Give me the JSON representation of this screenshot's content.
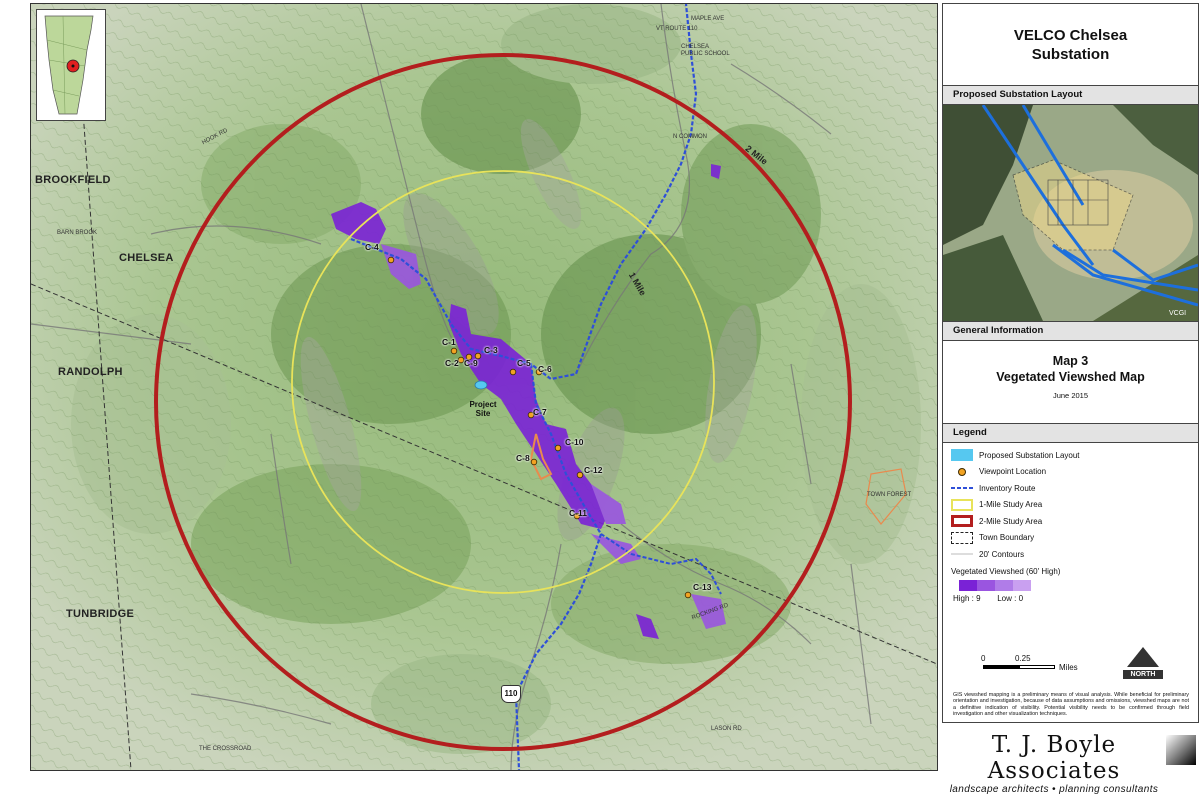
{
  "map": {
    "towns": [
      "BROOKFIELD",
      "CHELSEA",
      "RANDOLPH",
      "TUNBRIDGE"
    ],
    "ring_labels": {
      "one_mile": "1 Mile",
      "two_mile": "2 Mile"
    },
    "project_site_label": "Project Site",
    "route_shield": "110",
    "viewpoints": [
      "C-1",
      "C-2",
      "C-3",
      "C-4",
      "C-5",
      "C-6",
      "C-7",
      "C-8",
      "C-9",
      "C-10",
      "C-11",
      "C-12",
      "C-13"
    ],
    "road_labels": {
      "north_common": "N COMMON",
      "maple_ave": "MAPLE AVE",
      "vt110": "VT ROUTE 110",
      "school": "CHELSEA PUBLIC SCHOOL",
      "barn_brook": "BARN BROOK",
      "hook_rd": "HOOK RD",
      "town_forest": "TOWN FOREST",
      "the_crossroad": "THE CROSSROAD",
      "lasson_rd": "LASON RD",
      "rocking_rd": "ROCKING RD"
    },
    "colors": {
      "one_mile_ring": "#e8e35a",
      "two_mile_ring": "#b31e1e",
      "viewshed_high": "#7a22d6",
      "viewshed_low": "#c9a0f0",
      "route": "#2e4fd8",
      "substation": "#56c8f0"
    }
  },
  "panel": {
    "title_line1": "VELCO Chelsea",
    "title_line2": "Substation",
    "layout_header": "Proposed Substation Layout",
    "aerial_credit": "VCGI",
    "info_header": "General Information",
    "map_title_line1": "Map 3",
    "map_title_line2": "Vegetated Viewshed Map",
    "date": "June 2015",
    "legend_header": "Legend",
    "legend_items": [
      {
        "label": "Proposed Substation Layout",
        "symbol": "substation"
      },
      {
        "label": "Viewpoint Location",
        "symbol": "viewpoint"
      },
      {
        "label": "Inventory Route",
        "symbol": "route"
      },
      {
        "label": "1-Mile Study Area",
        "symbol": "one-mile"
      },
      {
        "label": "2-Mile Study Area",
        "symbol": "two-mile"
      },
      {
        "label": "Town Boundary",
        "symbol": "town"
      },
      {
        "label": "20' Contours",
        "symbol": "contour"
      }
    ],
    "viewshed_title": "Vegetated Viewshed (60' High)",
    "viewshed_high": "High : 9",
    "viewshed_low": "Low : 0",
    "scale_zero": "0",
    "scale_mid": "0.25",
    "scale_unit": "Miles",
    "north": "NORTH",
    "disclaimer": "GIS viewshed mapping is a preliminary means of visual analysis. While beneficial for preliminary orientation and investigation, because of data assumptions and omissions, viewshed maps are not a definitive indication of visibility. Potential visibility needs to be confirmed through field investigation and other visualization techniques."
  },
  "company": {
    "name": "T. J. Boyle Associates",
    "tagline": "landscape architects • planning consultants"
  }
}
